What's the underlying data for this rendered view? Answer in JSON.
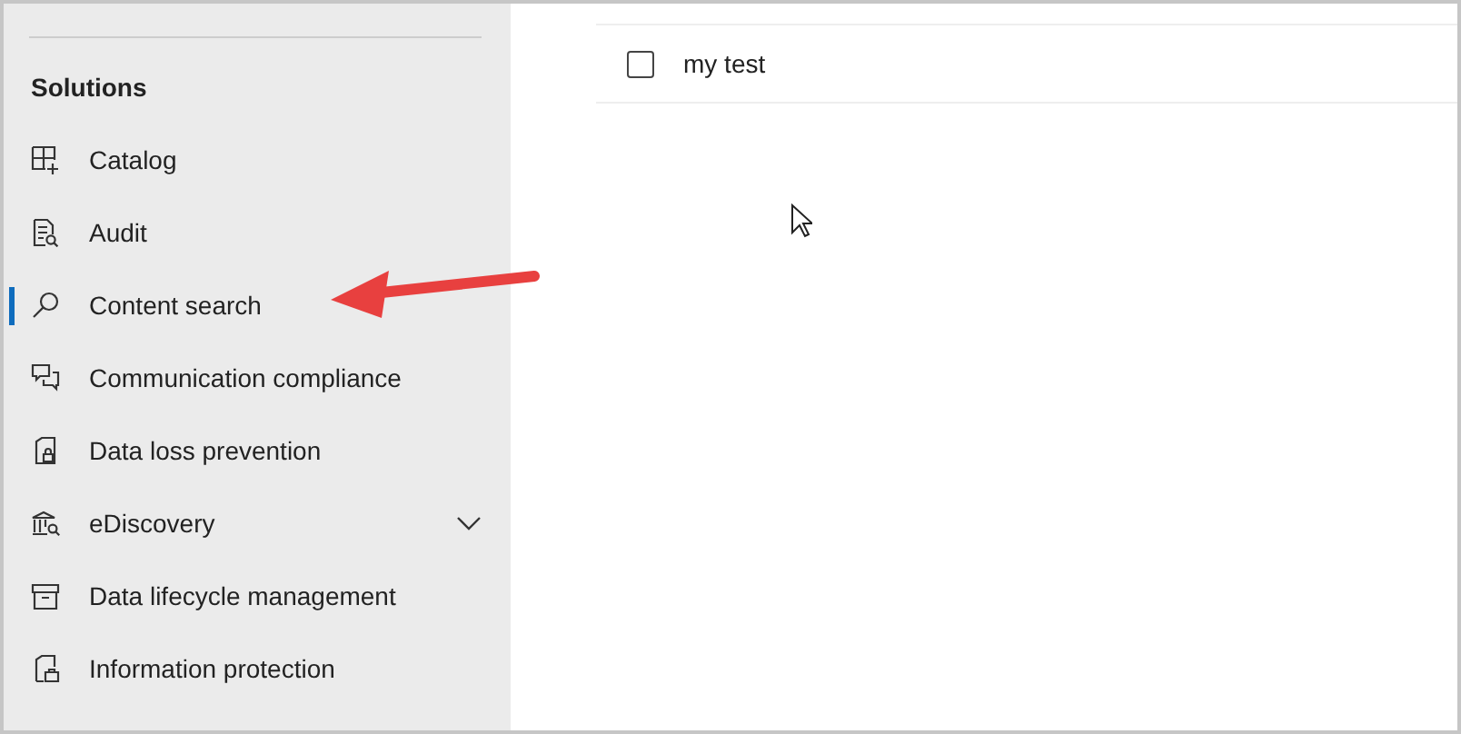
{
  "sidebar": {
    "section_title": "Solutions",
    "items": [
      {
        "label": "Catalog",
        "kind": "link",
        "selected": false
      },
      {
        "label": "Audit",
        "kind": "link",
        "selected": false
      },
      {
        "label": "Content search",
        "kind": "link",
        "selected": true
      },
      {
        "label": "Communication compliance",
        "kind": "link",
        "selected": false
      },
      {
        "label": "Data loss prevention",
        "kind": "link",
        "selected": false
      },
      {
        "label": "eDiscovery",
        "kind": "group",
        "selected": false,
        "expanded": false
      },
      {
        "label": "Data lifecycle management",
        "kind": "link",
        "selected": false
      },
      {
        "label": "Information protection",
        "kind": "link",
        "selected": false
      }
    ]
  },
  "table": {
    "rows": [
      {
        "name": "my test",
        "checked": false
      }
    ]
  }
}
